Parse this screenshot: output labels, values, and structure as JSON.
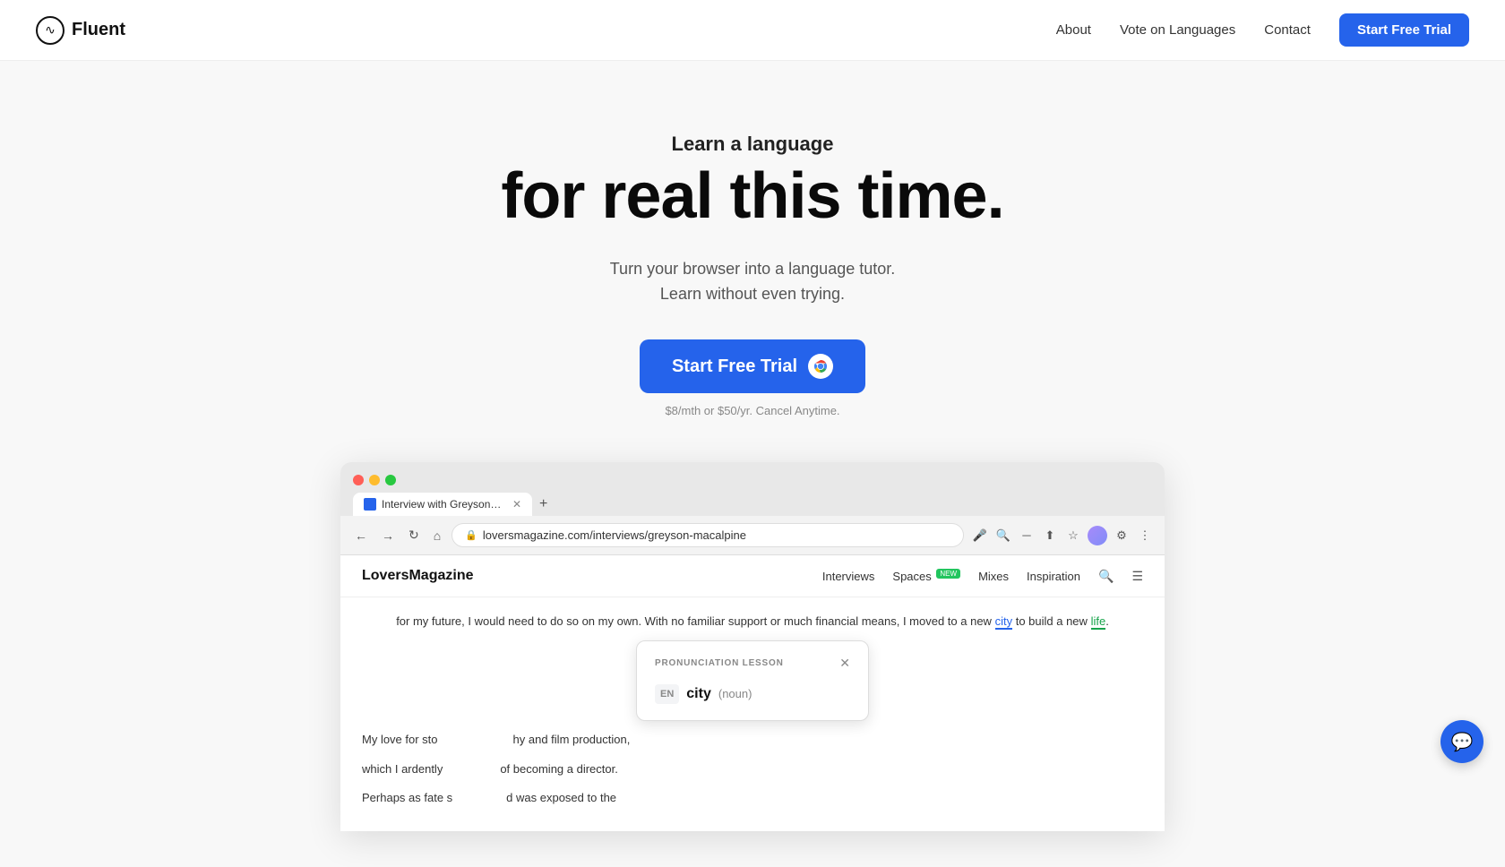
{
  "brand": {
    "logo_icon": "∿",
    "logo_text": "Fluent"
  },
  "navbar": {
    "links": [
      {
        "id": "about",
        "label": "About",
        "href": "#"
      },
      {
        "id": "vote",
        "label": "Vote on Languages",
        "href": "#"
      },
      {
        "id": "contact",
        "label": "Contact",
        "href": "#"
      }
    ],
    "cta_label": "Start Free Trial"
  },
  "hero": {
    "subtitle": "Learn a language",
    "title": "for real this time.",
    "description_line1": "Turn your browser into a language tutor.",
    "description_line2": "Learn without even trying.",
    "cta_label": "Start Free Trial",
    "pricing_note": "$8/mth or $50/yr. Cancel Anytime."
  },
  "browser": {
    "tab_title": "Interview with Greyson Ma",
    "url": "loversmagazine.com/interviews/greyson-macalpine",
    "webpage_logo": "LoversMagazine",
    "webpage_links": [
      {
        "label": "Interviews"
      },
      {
        "label": "Spaces",
        "badge": "NEW"
      },
      {
        "label": "Mixes"
      },
      {
        "label": "Inspiration"
      }
    ],
    "body_text_1": "for my future, I would need to do so on my own. With no familiar support or much financial means, I moved to a new",
    "word_city": "city",
    "body_text_2": "to build a new",
    "word_life": "life",
    "body_text_3": ".",
    "body_text_para2": "My love for sto",
    "body_text_para2b": "hy and film production,",
    "body_text_para3": "which I ardently",
    "body_text_para3b": "of becoming a director.",
    "body_text_para4": "Perhaps as fate s",
    "body_text_para4b": "d was exposed to the",
    "pronunciation_label": "PRONUNCIATION LESSON",
    "pronunciation_lang": "EN",
    "pronunciation_word": "city",
    "pronunciation_pos": "(noun)"
  },
  "colors": {
    "primary": "#2563eb",
    "text_dark": "#0a0a0a",
    "text_mid": "#555",
    "text_light": "#888"
  }
}
